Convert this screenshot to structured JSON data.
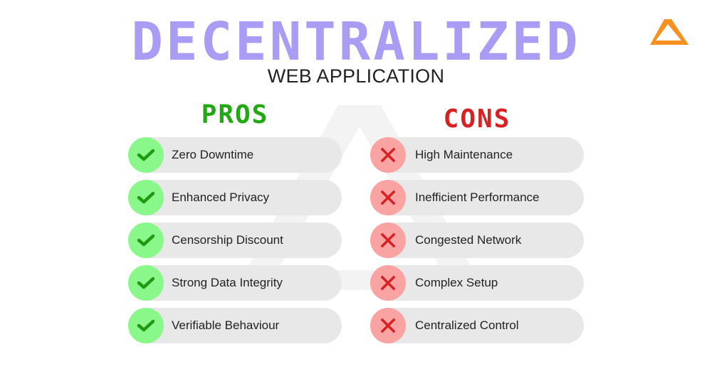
{
  "header": {
    "title": "DECENTRALIZED",
    "subtitle": "WEB APPLICATION",
    "logo_icon": "triangle-logo-icon"
  },
  "pros": {
    "heading": "PROS",
    "icon": "check-icon",
    "items": [
      {
        "label": "Zero Downtime"
      },
      {
        "label": "Enhanced Privacy"
      },
      {
        "label": "Censorship Discount"
      },
      {
        "label": "Strong Data Integrity"
      },
      {
        "label": "Verifiable Behaviour"
      }
    ]
  },
  "cons": {
    "heading": "CONS",
    "icon": "cross-icon",
    "items": [
      {
        "label": "High Maintenance"
      },
      {
        "label": "Inefficient Performance"
      },
      {
        "label": "Congested Network"
      },
      {
        "label": "Complex Setup"
      },
      {
        "label": "Centralized Control"
      }
    ]
  },
  "colors": {
    "title": "#a89cf4",
    "pros_heading": "#22a812",
    "cons_heading": "#d62222",
    "pros_badge": "#8af78a",
    "cons_badge": "#f9a3a3",
    "pill": "#e8e8e8",
    "logo": "#f7901e"
  }
}
